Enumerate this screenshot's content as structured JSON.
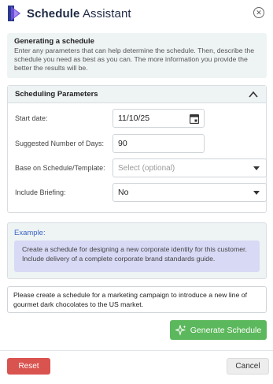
{
  "header": {
    "title_bold": "Schedule",
    "title_rest": " Assistant"
  },
  "info": {
    "title": "Generating a schedule",
    "text": "Enter any parameters that can help determine the schedule. Then, describe the schedule you need as best as you can. The more information you provide the better the results will be."
  },
  "params": {
    "heading": "Scheduling Parameters",
    "start_date": {
      "label": "Start date:",
      "value": "11/10/25"
    },
    "days": {
      "label": "Suggested Number of Days:",
      "value": "90"
    },
    "template": {
      "label": "Base on Schedule/Template:",
      "placeholder": "Select (optional)"
    },
    "briefing": {
      "label": "Include Briefing:",
      "value": "No"
    }
  },
  "example": {
    "label": "Example:",
    "text": "Create a schedule for designing a new corporate identity for this customer. Include delivery of a complete corporate brand standards guide."
  },
  "prompt": {
    "value": "Please create a schedule for a marketing campaign to introduce a new line of gourmet dark chocolates to the US market."
  },
  "buttons": {
    "generate": "Generate Schedule",
    "reset": "Reset",
    "cancel": "Cancel"
  },
  "colors": {
    "accent_green": "#5cb85c",
    "danger_red": "#d9534f",
    "link_blue": "#3a66c4",
    "example_bg": "#d8d9f5"
  },
  "icons": {
    "logo": "app-logo",
    "close": "close-circle-icon",
    "collapse": "chevron-up-icon",
    "calendar": "calendar-icon",
    "dropdown": "caret-down-icon",
    "sparkle": "sparkle-icon"
  }
}
